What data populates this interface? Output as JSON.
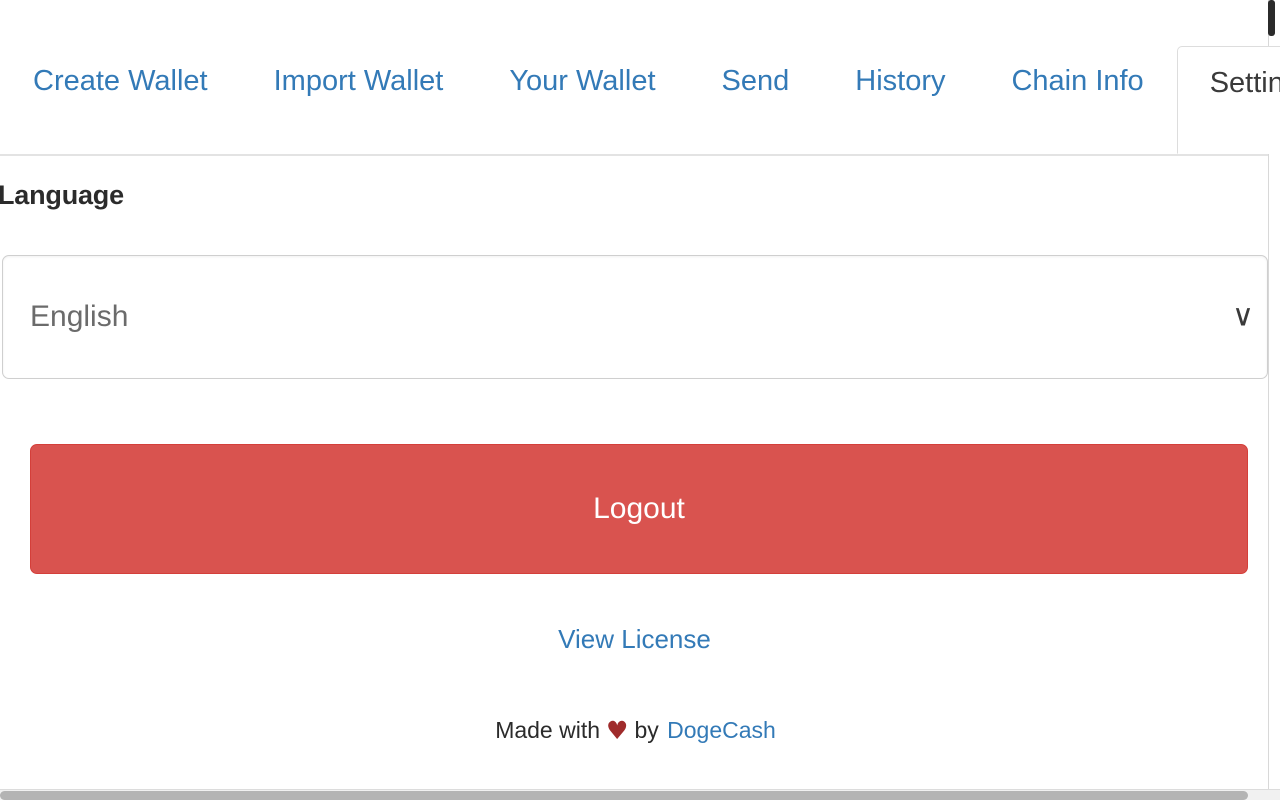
{
  "tabs": [
    {
      "label": "Create Wallet",
      "active": false
    },
    {
      "label": "Import Wallet",
      "active": false
    },
    {
      "label": "Your Wallet",
      "active": false
    },
    {
      "label": "Send",
      "active": false
    },
    {
      "label": "History",
      "active": false
    },
    {
      "label": "Chain Info",
      "active": false
    },
    {
      "label": "Settings",
      "active": true
    }
  ],
  "settings": {
    "language_label": "Language",
    "language_select": {
      "value": "English",
      "options": [
        "English"
      ],
      "chevron": "∨"
    },
    "logout_label": "Logout",
    "license_link": "View License"
  },
  "footer": {
    "made_with": "Made with",
    "heart": "♥",
    "by": "by",
    "brand": "DogeCash"
  },
  "colors": {
    "link": "#337ab7",
    "danger": "#d9534f",
    "danger_border": "#d43f3a",
    "heart": "#9f2b2b",
    "active_tab_text": "#3a3a3a",
    "select_value": "#6b6b6b"
  }
}
